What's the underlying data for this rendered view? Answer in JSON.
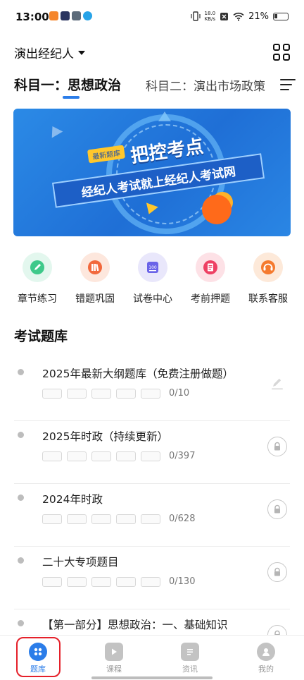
{
  "status_bar": {
    "time": "13:00",
    "net_speed_value": "18.0",
    "net_speed_unit": "KB/s",
    "battery": "21%"
  },
  "header": {
    "exam_name": "演出经纪人"
  },
  "subjects": {
    "active": "科目一：思想政治",
    "other": "科目二：演出市场政策"
  },
  "banner": {
    "tag": "最新题库",
    "title": "把控考点",
    "subtitle": "经纪人考试就上经纪人考试网"
  },
  "quick_links": [
    {
      "label": "章节练习",
      "icon": "pencil-icon",
      "color": "#3ec98a",
      "bg": "#e3f7ee"
    },
    {
      "label": "错题巩固",
      "icon": "books-icon",
      "color": "#f2683c",
      "bg": "#fde7dd"
    },
    {
      "label": "试卷中心",
      "icon": "paper-icon",
      "color": "#6a63e8",
      "bg": "#e9e7fb"
    },
    {
      "label": "考前押题",
      "icon": "document-icon",
      "color": "#ee4063",
      "bg": "#fde1e6"
    },
    {
      "label": "联系客服",
      "icon": "headset-icon",
      "color": "#f57a2e",
      "bg": "#fde9d9"
    }
  ],
  "section": {
    "title": "考试题库"
  },
  "question_banks": [
    {
      "title": "2025年最新大纲题库（免费注册做题）",
      "count": "0/10",
      "action": "edit-icon",
      "progress": 0
    },
    {
      "title": "2025年时政（持续更新）",
      "count": "0/397",
      "action": "lock-icon",
      "progress": 0
    },
    {
      "title": "2024年时政",
      "count": "0/628",
      "action": "lock-icon",
      "progress": 0
    },
    {
      "title": "二十大专项题目",
      "count": "0/130",
      "action": "lock-icon",
      "progress": 0
    },
    {
      "title": "【第一部分】思想政治：一、基础知识",
      "count": "",
      "action": "lock-icon",
      "progress": 0
    }
  ],
  "tabs": [
    {
      "label": "题库",
      "icon": "grid-dots-icon",
      "active": true
    },
    {
      "label": "课程",
      "icon": "play-icon",
      "active": false
    },
    {
      "label": "资讯",
      "icon": "news-icon",
      "active": false
    },
    {
      "label": "我的",
      "icon": "profile-icon",
      "active": false
    }
  ],
  "colors": {
    "accent": "#2b7de9",
    "highlight": "#e5202a"
  }
}
